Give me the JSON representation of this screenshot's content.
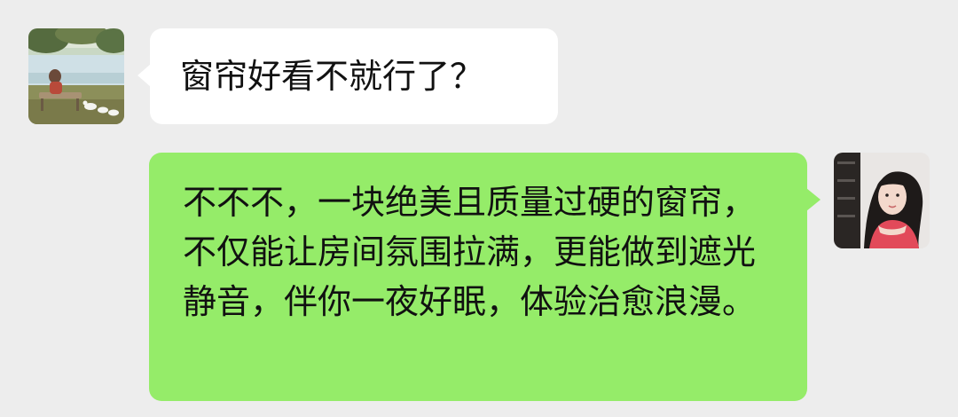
{
  "colors": {
    "background": "#ededed",
    "incoming_bubble": "#ffffff",
    "outgoing_bubble": "#95ec69",
    "text": "#111111"
  },
  "messages": [
    {
      "sender": "other",
      "avatar": "outdoor-photo-avatar",
      "text": "窗帘好看不就行了？"
    },
    {
      "sender": "self",
      "avatar": "portrait-photo-avatar",
      "text": "不不不，一块绝美且质量过硬的窗帘，不仅能让房间氛围拉满，更能做到遮光静音，伴你一夜好眠，体验治愈浪漫。"
    }
  ]
}
